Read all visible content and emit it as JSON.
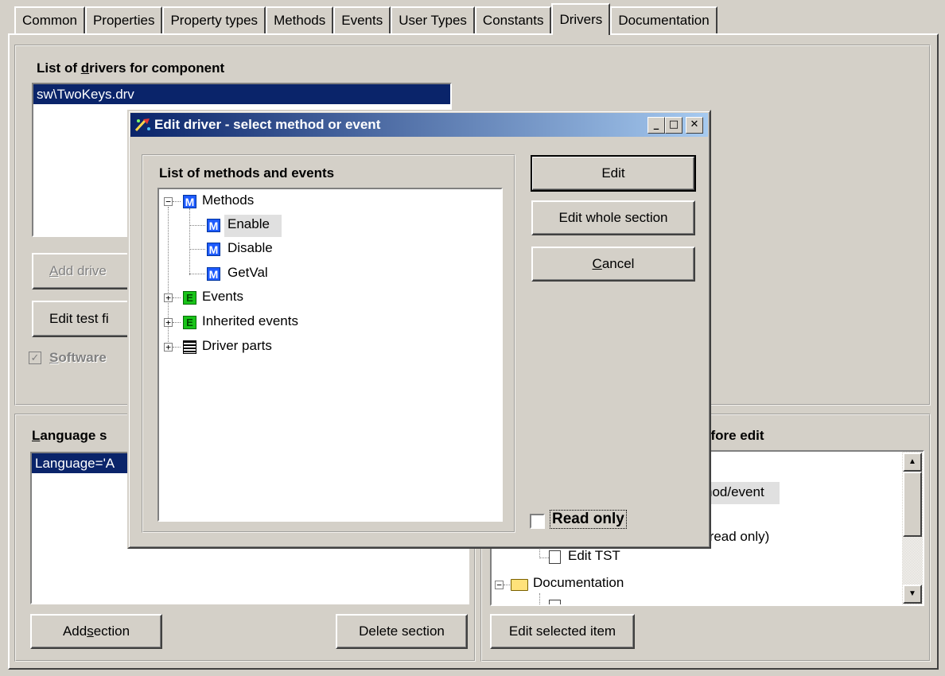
{
  "tabs": [
    "Common",
    "Properties",
    "Property types",
    "Methods",
    "Events",
    "User Types",
    "Constants",
    "Drivers",
    "Documentation"
  ],
  "drivers_panel": {
    "title_prefix": "List of ",
    "title_mnemonic": "d",
    "title_rest": "rivers for component",
    "selected_driver": "sw\\TwoKeys.drv",
    "add_driver_mnemonic": "A",
    "add_driver_rest": "dd drive",
    "edit_test_label": "Edit test fi",
    "software_mnemonic": "S",
    "software_rest": "oftware"
  },
  "language_panel": {
    "title_mnemonic": "L",
    "title_rest": "anguage s",
    "selected_item": "Language='A",
    "add_section_prefix": "Add ",
    "add_section_mnemonic": "s",
    "add_section_rest": "ection",
    "delete_section": "Delete section"
  },
  "right_panel": {
    "title_partial": "efore edit",
    "tree_method_event": "hod/event",
    "tree_read_only": "(read only)",
    "tree_edit_tst": "Edit TST",
    "tree_documentation": "Documentation",
    "edit_selected": "Edit selected item"
  },
  "dialog": {
    "title": "Edit driver - select method or event",
    "list_title": "List of methods and events",
    "tree": {
      "methods": "Methods",
      "enable": "Enable",
      "disable": "Disable",
      "getval": "GetVal",
      "events": "Events",
      "inherited": "Inherited events",
      "driver_parts": "Driver parts"
    },
    "buttons": {
      "edit": "Edit",
      "edit_whole": "Edit whole section",
      "cancel_mnemonic": "C",
      "cancel_rest": "ancel"
    },
    "read_only": "Read only"
  },
  "colors": {
    "selection": "#0a246a",
    "face": "#d4d0c8"
  }
}
